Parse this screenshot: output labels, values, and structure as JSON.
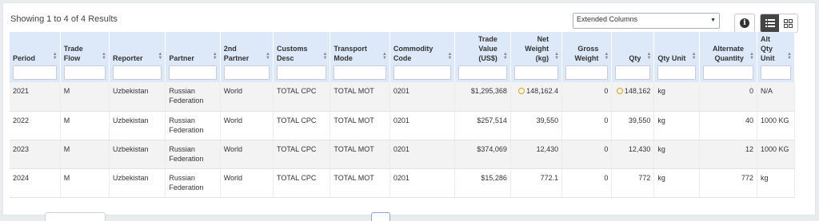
{
  "results_text": "Showing 1 to 4 of 4 Results",
  "column_select": {
    "selected": "Extended Columns"
  },
  "columns": [
    {
      "key": "period",
      "label": "Period",
      "align": "left"
    },
    {
      "key": "trade_flow",
      "label": "Trade Flow",
      "align": "left"
    },
    {
      "key": "reporter",
      "label": "Reporter",
      "align": "left"
    },
    {
      "key": "partner",
      "label": "Partner",
      "align": "left"
    },
    {
      "key": "partner2",
      "label": "2nd Partner",
      "align": "left"
    },
    {
      "key": "customs",
      "label": "Customs Desc",
      "align": "left"
    },
    {
      "key": "transport",
      "label": "Transport Mode",
      "align": "left"
    },
    {
      "key": "commodity",
      "label": "Commodity Code",
      "align": "left"
    },
    {
      "key": "trade_value",
      "label": "Trade Value (US$)",
      "align": "right"
    },
    {
      "key": "net_weight",
      "label": "Net Weight (kg)",
      "align": "right"
    },
    {
      "key": "gross_weight",
      "label": "Gross Weight",
      "align": "right"
    },
    {
      "key": "qty",
      "label": "Qty",
      "align": "right"
    },
    {
      "key": "qty_unit",
      "label": "Qty Unit",
      "align": "left"
    },
    {
      "key": "alt_qty",
      "label": "Alternate Quantity",
      "align": "right"
    },
    {
      "key": "alt_qty_unit",
      "label": "Alt Qty Unit",
      "align": "left"
    }
  ],
  "rows": [
    {
      "period": "2021",
      "trade_flow": "M",
      "reporter": "Uzbekistan",
      "partner": "Russian Federation",
      "partner2": "World",
      "customs": "TOTAL CPC",
      "transport": "TOTAL MOT",
      "commodity": "0201",
      "trade_value": "$1,295,368",
      "net_weight": "148,162.4",
      "net_weight_warn": true,
      "gross_weight": "0",
      "qty": "148,162",
      "qty_warn": true,
      "qty_unit": "kg",
      "alt_qty": "0",
      "alt_qty_unit": "N/A"
    },
    {
      "period": "2022",
      "trade_flow": "M",
      "reporter": "Uzbekistan",
      "partner": "Russian Federation",
      "partner2": "World",
      "customs": "TOTAL CPC",
      "transport": "TOTAL MOT",
      "commodity": "0201",
      "trade_value": "$257,514",
      "net_weight": "39,550",
      "net_weight_warn": false,
      "gross_weight": "0",
      "qty": "39,550",
      "qty_warn": false,
      "qty_unit": "kg",
      "alt_qty": "40",
      "alt_qty_unit": "1000 KG"
    },
    {
      "period": "2023",
      "trade_flow": "M",
      "reporter": "Uzbekistan",
      "partner": "Russian Federation",
      "partner2": "World",
      "customs": "TOTAL CPC",
      "transport": "TOTAL MOT",
      "commodity": "0201",
      "trade_value": "$374,069",
      "net_weight": "12,430",
      "net_weight_warn": false,
      "gross_weight": "0",
      "qty": "12,430",
      "qty_warn": false,
      "qty_unit": "kg",
      "alt_qty": "12",
      "alt_qty_unit": "1000 KG"
    },
    {
      "period": "2024",
      "trade_flow": "M",
      "reporter": "Uzbekistan",
      "partner": "Russian Federation",
      "partner2": "World",
      "customs": "TOTAL CPC",
      "transport": "TOTAL MOT",
      "commodity": "0201",
      "trade_value": "$15,286",
      "net_weight": "772.1",
      "net_weight_warn": false,
      "gross_weight": "0",
      "qty": "772",
      "qty_warn": false,
      "qty_unit": "kg",
      "alt_qty": "772",
      "alt_qty_unit": "kg"
    }
  ],
  "icons": {
    "info": "info-icon",
    "list_view": "list-view-icon",
    "grid_view": "grid-view-icon",
    "warning": "warning-circle-icon",
    "sort": "sort-icon"
  },
  "colors": {
    "header_bg": "#dde9f8",
    "active_view": "#444444",
    "warning": "#e0a020"
  }
}
